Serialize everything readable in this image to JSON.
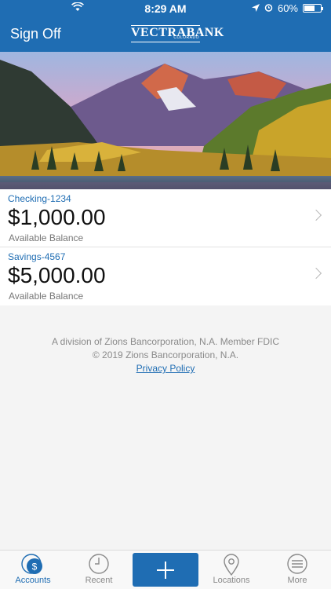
{
  "status_bar": {
    "time": "8:29 AM",
    "battery": "60%"
  },
  "header": {
    "sign_off_label": "Sign Off",
    "logo_text": "VECTRABANK",
    "logo_sub": "COLORADO"
  },
  "accounts": [
    {
      "name": "Checking-1234",
      "amount": "$1,000.00",
      "label": "Available Balance"
    },
    {
      "name": "Savings-4567",
      "amount": "$5,000.00",
      "label": "Available Balance"
    }
  ],
  "footer": {
    "line1": "A division of Zions Bancorporation, N.A. Member FDIC",
    "line2": "© 2019 Zions Bancorporation, N.A.",
    "privacy_link": "Privacy Policy"
  },
  "tabs": [
    {
      "label": "Accounts",
      "icon": "accounts-icon",
      "active": true
    },
    {
      "label": "Recent",
      "icon": "clock-icon",
      "active": false
    },
    {
      "label": "",
      "icon": "plus-icon",
      "active": false
    },
    {
      "label": "Locations",
      "icon": "location-pin-icon",
      "active": false
    },
    {
      "label": "More",
      "icon": "menu-icon",
      "active": false
    }
  ],
  "colors": {
    "brand": "#1f6db3",
    "background": "#f4f4f4"
  }
}
